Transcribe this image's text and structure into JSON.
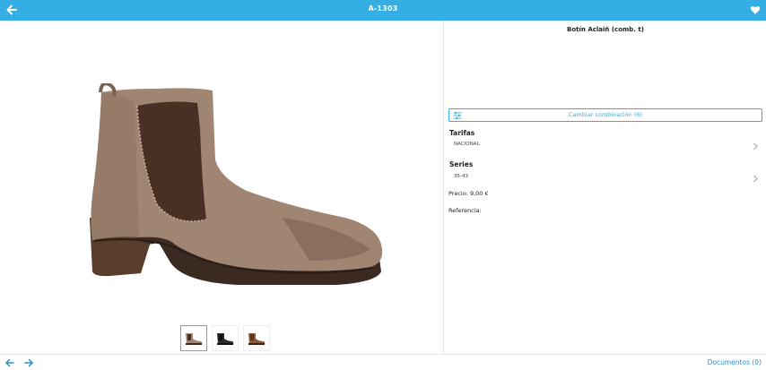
{
  "header": {
    "title": "A-1303",
    "back_icon": "arrow-left-icon",
    "favorite_icon": "heart-icon",
    "accent_color": "#35aee3"
  },
  "product": {
    "name": "Botín Aclaiñ (comb. t)",
    "combination_button": "Cambiar combinación (6)",
    "tarifas_label": "Tarifas",
    "tarifas_value": "NACIONAL",
    "series_label": "Series",
    "series_value": "35-43",
    "price": "Precio: 9,00 €",
    "reference": "Referencia:"
  },
  "gallery": {
    "thumbnails": [
      "boot-taupe",
      "boot-black",
      "boot-brown"
    ],
    "active_index": 0
  },
  "footer": {
    "documents_link": "Documentos (0)",
    "prev_icon": "arrow-left-icon",
    "next_icon": "arrow-right-icon"
  }
}
